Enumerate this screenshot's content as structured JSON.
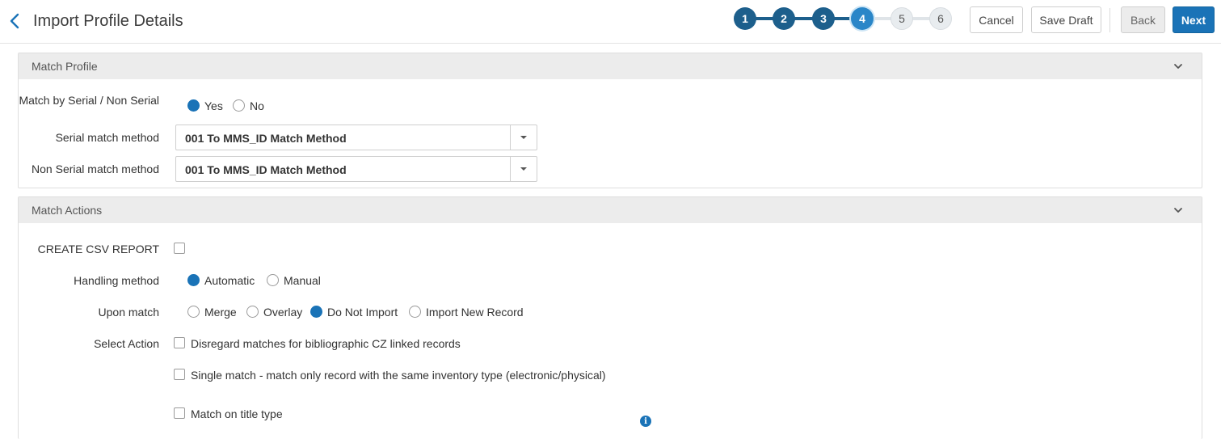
{
  "header": {
    "title": "Import Profile Details",
    "steps": [
      "1",
      "2",
      "3",
      "4",
      "5",
      "6"
    ],
    "current_step": 4,
    "buttons": {
      "cancel": "Cancel",
      "save_draft": "Save Draft",
      "back": "Back",
      "next": "Next"
    }
  },
  "match_profile": {
    "title": "Match Profile",
    "serial_non_serial": {
      "label": "Match by Serial / Non Serial",
      "options": [
        "Yes",
        "No"
      ],
      "selected": "Yes"
    },
    "serial_method": {
      "label": "Serial match method",
      "value": "001 To MMS_ID Match Method"
    },
    "non_serial_method": {
      "label": "Non Serial match method",
      "value": "001 To MMS_ID Match Method"
    }
  },
  "match_actions": {
    "title": "Match Actions",
    "csv_report": {
      "label": "CREATE CSV REPORT",
      "checked": false
    },
    "handling_method": {
      "label": "Handling method",
      "options": [
        "Automatic",
        "Manual"
      ],
      "selected": "Automatic"
    },
    "upon_match": {
      "label": "Upon match",
      "options": [
        "Merge",
        "Overlay",
        "Do Not Import",
        "Import New Record"
      ],
      "selected": "Do Not Import"
    },
    "select_action": {
      "label": "Select Action",
      "options": [
        {
          "text": "Disregard matches for bibliographic CZ linked records",
          "checked": false
        },
        {
          "text": "Single match - match only record with the same inventory type (electronic/physical)",
          "checked": false
        },
        {
          "text": "Match on title type",
          "checked": false
        }
      ]
    }
  },
  "icons": {
    "back": "chevron-left-icon",
    "collapse": "chevron-down-icon",
    "select_caret": "caret-down-icon",
    "info": "info-icon"
  },
  "colors": {
    "primary": "#1a73b7",
    "step_done": "#1d5f8c",
    "step_current": "#2a86c8",
    "section_header": "#ececec"
  }
}
